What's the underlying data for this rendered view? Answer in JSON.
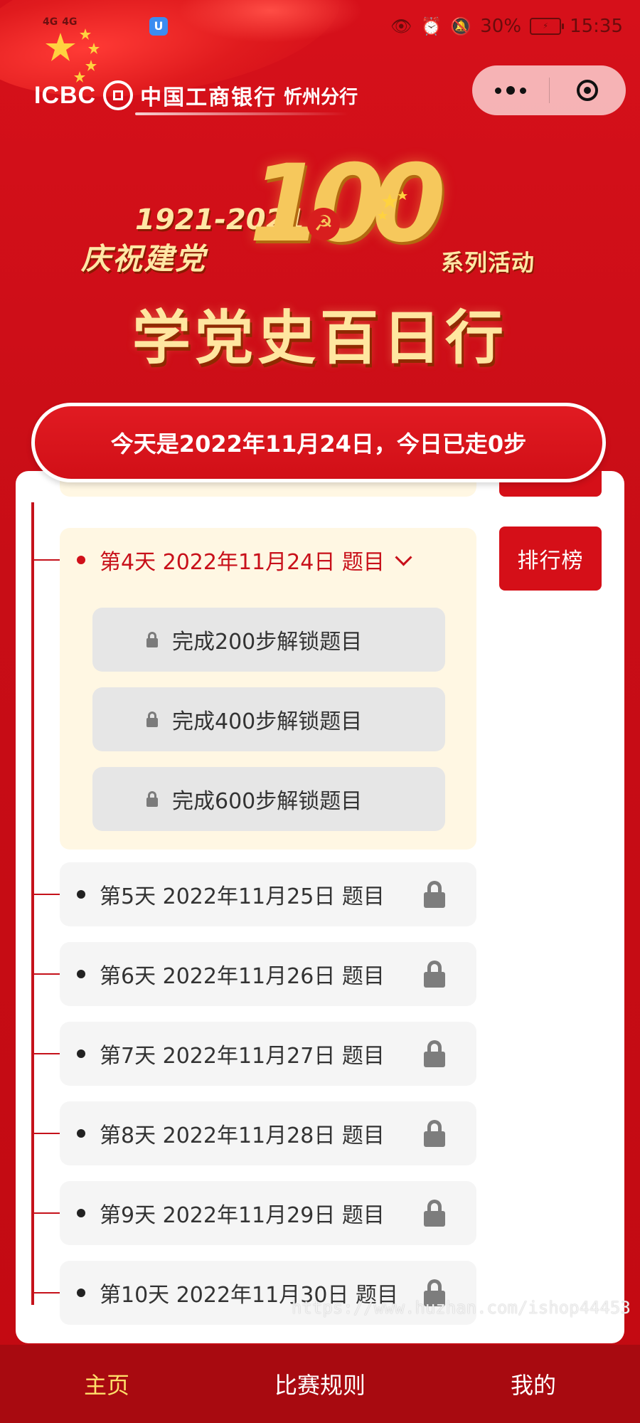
{
  "status_bar": {
    "left_signals": [
      "4G",
      "4G"
    ],
    "app_icon": "U",
    "battery": "30%",
    "time": "15:35",
    "icons": [
      "eye-icon",
      "alarm-icon",
      "mute-icon",
      "battery-icon"
    ]
  },
  "header": {
    "bank_logo_text": "ICBC",
    "bank_name": "中国工商银行",
    "branch_name": "忻州分行"
  },
  "capsule": {
    "more_icon": "more-dots-icon",
    "close_icon": "target-close-icon"
  },
  "banner": {
    "years": "1921-2021",
    "celebrate": "庆祝建党",
    "hundred": "100",
    "emblem": "☭",
    "series": "系列活动",
    "main_title": "学党史百日行"
  },
  "date_bar": {
    "text": "今天是2022年11月24日，今日已走0步"
  },
  "rank_button": {
    "label": "排行榜"
  },
  "current_day": {
    "label": "第4天 2022年11月24日 题目",
    "questions": [
      {
        "text": "完成200步解锁题目"
      },
      {
        "text": "完成400步解锁题目"
      },
      {
        "text": "完成600步解锁题目"
      }
    ]
  },
  "days": [
    {
      "label": "第5天 2022年11月25日 题目"
    },
    {
      "label": "第6天 2022年11月26日 题目"
    },
    {
      "label": "第7天 2022年11月27日 题目"
    },
    {
      "label": "第8天 2022年11月28日 题目"
    },
    {
      "label": "第9天 2022年11月29日 题目"
    },
    {
      "label": "第10天 2022年11月30日 题目"
    }
  ],
  "watermark": "https://www.huzhan.com/ishop44453",
  "bottom_nav": {
    "items": [
      {
        "label": "主页",
        "active": true
      },
      {
        "label": "比赛规则",
        "active": false
      },
      {
        "label": "我的",
        "active": false
      }
    ]
  },
  "colors": {
    "primary_red": "#d50f18",
    "gold": "#f6c85c",
    "highlight_bg": "#fff7e3",
    "active_nav": "#ffdf6a"
  }
}
